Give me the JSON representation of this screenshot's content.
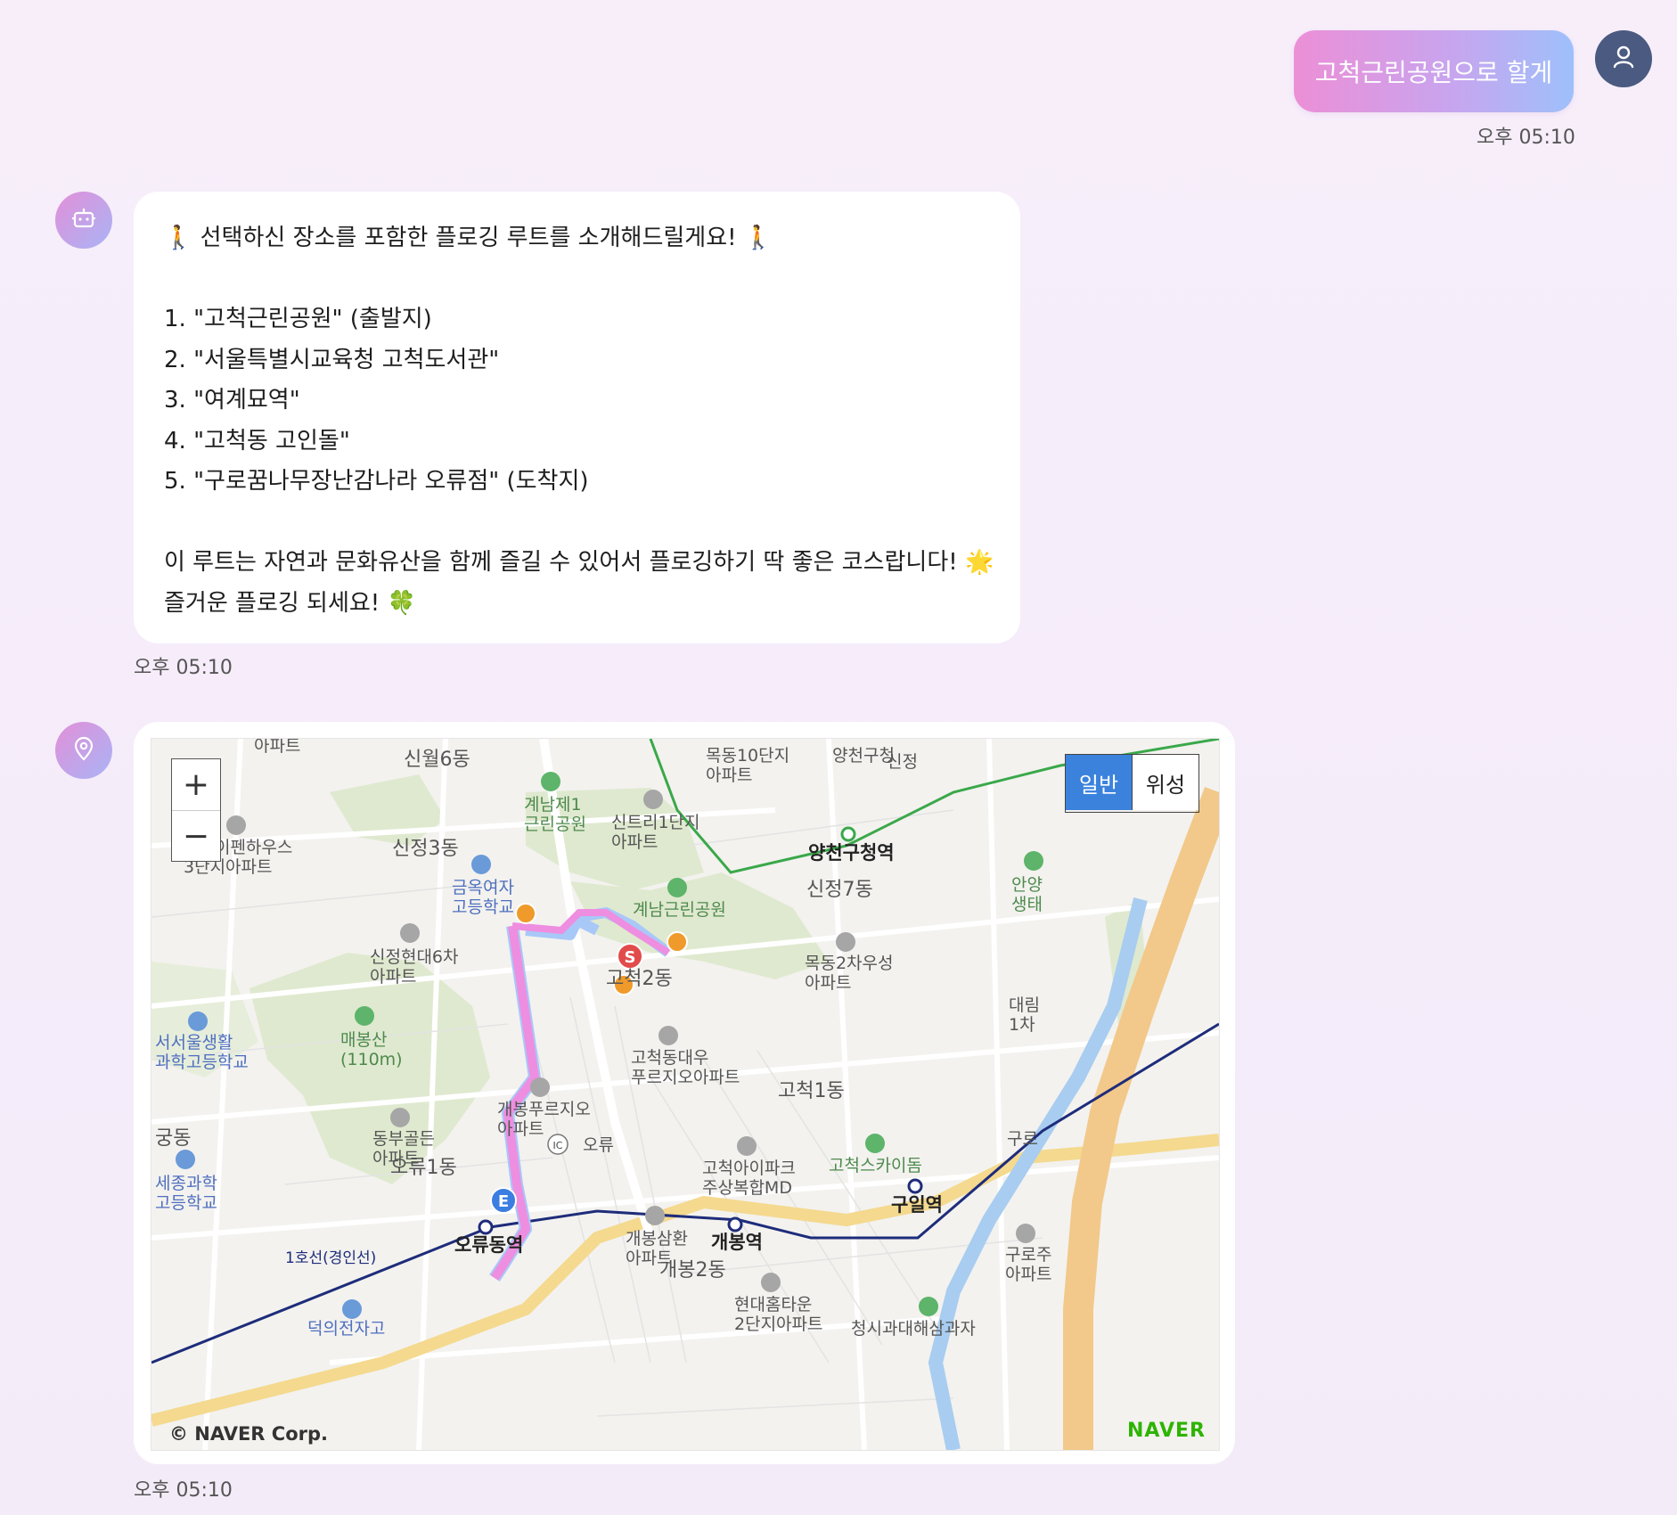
{
  "user_message": {
    "text": "고척근린공원으로 할게",
    "time": "오후 05:10"
  },
  "bot_message": {
    "intro": "🚶 선택하신 장소를 포함한 플로깅 루트를 소개해드릴게요! 🚶",
    "items": [
      "1. \"고척근린공원\" (출발지)",
      "2. \"서울특별시교육청 고척도서관\"",
      "3. \"여계묘역\"",
      "4. \"고척동 고인돌\"",
      "5. \"구로꿈나무장난감나라 오류점\" (도착지)"
    ],
    "outro1": "이 루트는 자연과 문화유산을 함께 즐길 수 있어서 플로깅하기 딱 좋은 코스랍니다! 🌟",
    "outro2": "즐거운 플로깅 되세요! 🍀",
    "time": "오후 05:10"
  },
  "map_message": {
    "time": "오후 05:10",
    "zoom_in": "+",
    "zoom_out": "−",
    "map_type_normal": "일반",
    "map_type_satellite": "위성",
    "copyright": "© NAVER Corp.",
    "brand": "NAVER",
    "start_marker": "S",
    "end_marker": "E",
    "labels": {
      "sinwol6": "신월6동",
      "sinjeong3": "신정3동",
      "sinjeong7": "신정7동",
      "gocheok2": "고척2동",
      "gocheok1": "고척1동",
      "oryu1": "오류1동",
      "gaebong2": "개봉2동",
      "gungdong": "궁동",
      "gyenamje1": "계남제1\n근린공원",
      "gyenampark": "계남근린공원",
      "sintree": "신트리1단지\n아파트",
      "geumok": "금옥여자\n고등학교",
      "sinjeonghyundai": "신정현대6차\n아파트",
      "maebongsan": "매봉산\n(110m)",
      "seoseoul": "서서울생활\n과학고등학교",
      "dongbu": "동부골든\n아파트",
      "sejong": "세종과학\n고등학교",
      "gaebongpru": "개봉푸르지오\n아파트",
      "gocheokdaewoo": "고척동대우\n푸르지오아파트",
      "mokdong2": "목동2차우성\n아파트",
      "yangcheon_station": "양천구청역",
      "yangcheon_office": "양천구청",
      "oryu_station": "오류동역",
      "gaebong_station": "개봉역",
      "guil_station": "구일역",
      "line1": "1호선(경인선)",
      "oryu_ic": "오류",
      "ic": "IC",
      "gocheok_skydome": "고척스카이돔",
      "gocheok_ipark": "고척아이파크\n주상복합MD",
      "gaebong_samhwan": "개봉삼환\n아파트",
      "hyundai_home": "현대홈타운\n2단지아파트",
      "sinjeong_ipen": "신정이펜하우스\n3단지아파트",
      "apt_top": "아파트",
      "mokdong10": "목동10단지\n아파트",
      "anyang": "안양\n생태",
      "daerim": "대림\n1차",
      "guro": "구로",
      "guro_apt": "구로주\n아파트",
      "sinjeong_edge": "신정",
      "bottom_school": "덕의전자고",
      "bottom_edge": "청시과대해삼과자"
    }
  },
  "colors": {
    "route": "#ee8ee0",
    "route_outline": "#a8c8f8",
    "start": "#e24b4b",
    "end": "#3b7de0",
    "waypoint": "#ef9a2a",
    "park": "#dfe9cf",
    "river": "#a8cdf0",
    "major_road": "#f4d98f",
    "subway_line1": "#1e2c7a",
    "subway_line2": "#3aa84a"
  }
}
